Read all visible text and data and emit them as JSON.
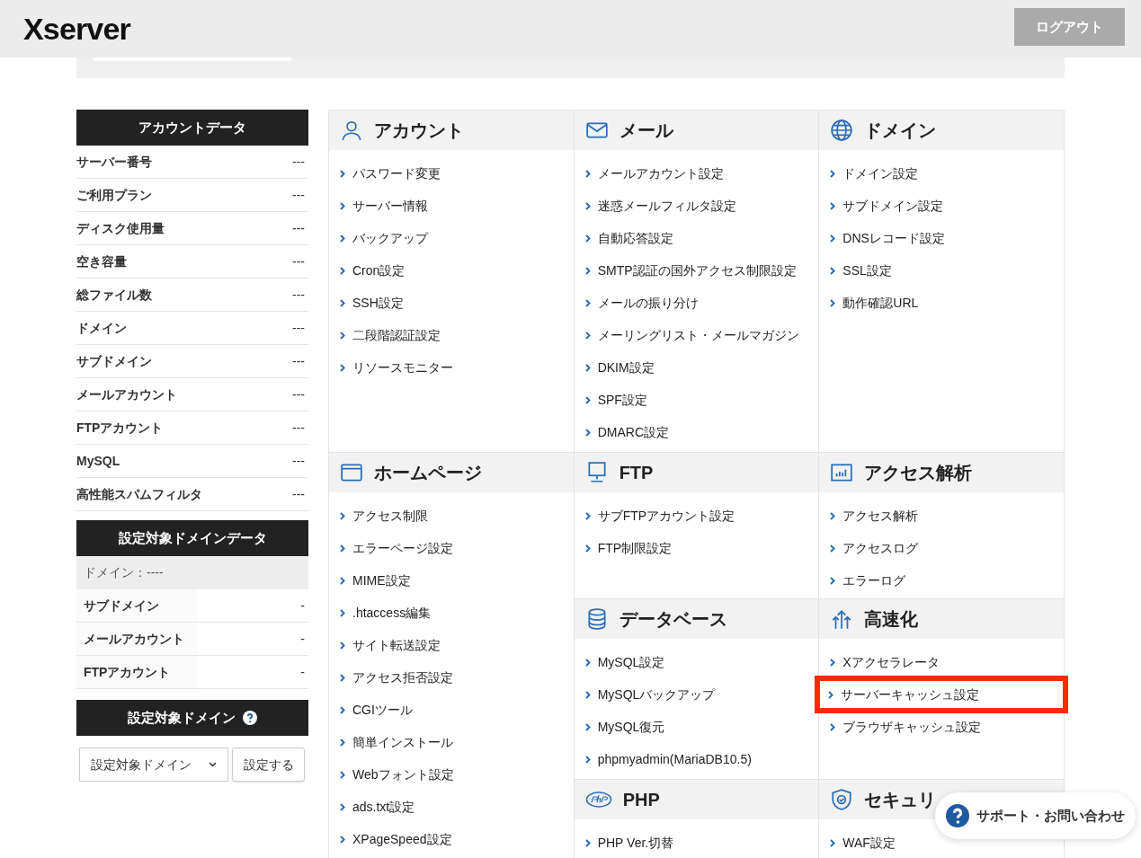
{
  "header": {
    "logo": "Xserver",
    "logout": "ログアウト"
  },
  "sidebar": {
    "account_data": {
      "title": "アカウントデータ",
      "rows": [
        {
          "label": "サーバー番号",
          "value": "---"
        },
        {
          "label": "ご利用プラン",
          "value": "---"
        },
        {
          "label": "ディスク使用量",
          "value": "---"
        },
        {
          "label": "空き容量",
          "value": "---"
        },
        {
          "label": "総ファイル数",
          "value": "---"
        },
        {
          "label": "ドメイン",
          "value": "---"
        },
        {
          "label": "サブドメイン",
          "value": "---"
        },
        {
          "label": "メールアカウント",
          "value": "---"
        },
        {
          "label": "FTPアカウント",
          "value": "---"
        },
        {
          "label": "MySQL",
          "value": "---"
        },
        {
          "label": "高性能スパムフィルタ",
          "value": "---"
        }
      ]
    },
    "domain_data": {
      "title": "設定対象ドメインデータ",
      "domain": "ドメイン：----",
      "rows": [
        {
          "label": "サブドメイン",
          "value": "-"
        },
        {
          "label": "メールアカウント",
          "value": "-"
        },
        {
          "label": "FTPアカウント",
          "value": "-"
        }
      ]
    },
    "target_domain": {
      "title": "設定対象ドメイン",
      "select_value": "設定対象ドメイン",
      "button": "設定する"
    }
  },
  "sections": [
    {
      "title": "アカウント",
      "items": [
        {
          "label": "パスワード変更",
          "highlighted": false
        },
        {
          "label": "サーバー情報",
          "highlighted": false
        },
        {
          "label": "バックアップ",
          "highlighted": false
        },
        {
          "label": "Cron設定",
          "highlighted": false
        },
        {
          "label": "SSH設定",
          "highlighted": false
        },
        {
          "label": "二段階認証設定",
          "highlighted": false
        },
        {
          "label": "リソースモニター",
          "highlighted": false
        }
      ]
    },
    {
      "title": "メール",
      "items": [
        {
          "label": "メールアカウント設定",
          "highlighted": false
        },
        {
          "label": "迷惑メールフィルタ設定",
          "highlighted": false
        },
        {
          "label": "自動応答設定",
          "highlighted": false
        },
        {
          "label": "SMTP認証の国外アクセス制限設定",
          "highlighted": false
        },
        {
          "label": "メールの振り分け",
          "highlighted": false
        },
        {
          "label": "メーリングリスト・メールマガジン",
          "highlighted": false
        },
        {
          "label": "DKIM設定",
          "highlighted": false
        },
        {
          "label": "SPF設定",
          "highlighted": false
        },
        {
          "label": "DMARC設定",
          "highlighted": false
        }
      ]
    },
    {
      "title": "ドメイン",
      "items": [
        {
          "label": "ドメイン設定",
          "highlighted": false
        },
        {
          "label": "サブドメイン設定",
          "highlighted": false
        },
        {
          "label": "DNSレコード設定",
          "highlighted": false
        },
        {
          "label": "SSL設定",
          "highlighted": false
        },
        {
          "label": "動作確認URL",
          "highlighted": false
        }
      ]
    },
    {
      "title": "ホームページ",
      "items": [
        {
          "label": "アクセス制限",
          "highlighted": false
        },
        {
          "label": "エラーページ設定",
          "highlighted": false
        },
        {
          "label": "MIME設定",
          "highlighted": false
        },
        {
          "label": ".htaccess編集",
          "highlighted": false
        },
        {
          "label": "サイト転送設定",
          "highlighted": false
        },
        {
          "label": "アクセス拒否設定",
          "highlighted": false
        },
        {
          "label": "CGIツール",
          "highlighted": false
        },
        {
          "label": "簡単インストール",
          "highlighted": false
        },
        {
          "label": "Webフォント設定",
          "highlighted": false
        },
        {
          "label": "ads.txt設定",
          "highlighted": false
        },
        {
          "label": "XPageSpeed設定",
          "highlighted": false
        }
      ]
    },
    {
      "title": "FTP",
      "items": [
        {
          "label": "サブFTPアカウント設定",
          "highlighted": false
        },
        {
          "label": "FTP制限設定",
          "highlighted": false
        }
      ]
    },
    {
      "title": "アクセス解析",
      "items": [
        {
          "label": "アクセス解析",
          "highlighted": false
        },
        {
          "label": "アクセスログ",
          "highlighted": false
        },
        {
          "label": "エラーログ",
          "highlighted": false
        }
      ]
    },
    {
      "title": "データベース",
      "items": [
        {
          "label": "MySQL設定",
          "highlighted": false
        },
        {
          "label": "MySQLバックアップ",
          "highlighted": false
        },
        {
          "label": "MySQL復元",
          "highlighted": false
        },
        {
          "label": "phpmyadmin(MariaDB10.5)",
          "highlighted": false
        }
      ]
    },
    {
      "title": "高速化",
      "items": [
        {
          "label": "Xアクセラレータ",
          "highlighted": false
        },
        {
          "label": "サーバーキャッシュ設定",
          "highlighted": true
        },
        {
          "label": "ブラウザキャッシュ設定",
          "highlighted": false
        }
      ]
    },
    {
      "title": "PHP",
      "items": [
        {
          "label": "PHP Ver.切替",
          "highlighted": false
        }
      ]
    },
    {
      "title": "セキュリ",
      "items": [
        {
          "label": "WAF設定",
          "highlighted": false
        }
      ]
    }
  ],
  "support_button": "サポート・お問い合わせ"
}
